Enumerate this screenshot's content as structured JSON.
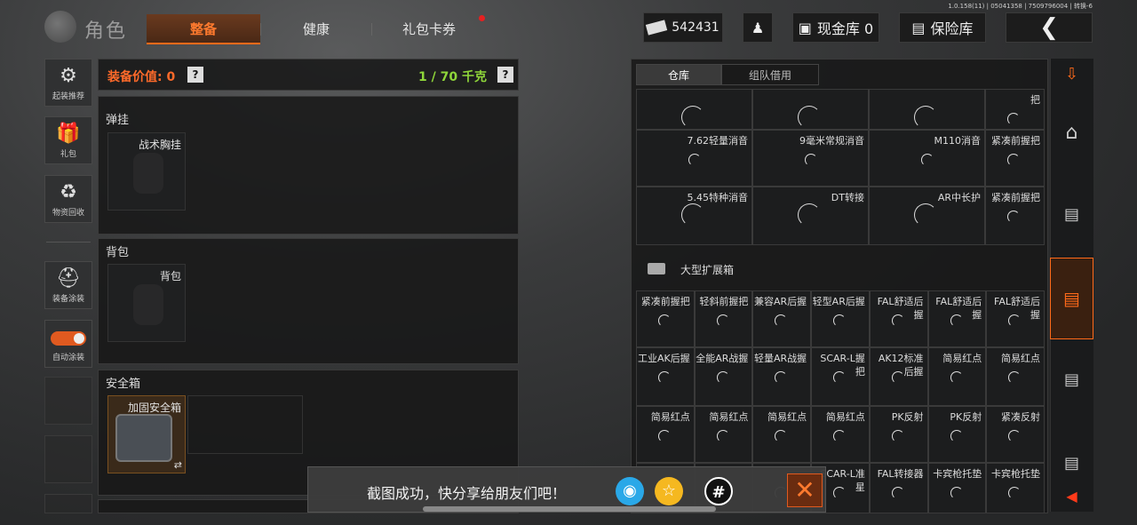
{
  "version": "1.0.158(11) | 05041358 | 7509796004 | 转换-6",
  "header": {
    "title": "角色",
    "tabs": [
      {
        "label": "整备",
        "active": true
      },
      {
        "label": "健康",
        "active": false
      },
      {
        "label": "礼包卡券",
        "active": false
      }
    ],
    "money": "542431",
    "cash_storage": "现金库 0",
    "safe_storage": "保险库"
  },
  "left_sidebar": {
    "items": [
      {
        "label": "起装推荐",
        "icon": "gun-icon"
      },
      {
        "label": "礼包",
        "icon": "gift-icon"
      },
      {
        "label": "物资回收",
        "icon": "recycle-icon"
      },
      {
        "label": "装备涂装",
        "icon": "helmet-icon"
      },
      {
        "label": "自动涂装",
        "icon": "toggle-icon"
      }
    ]
  },
  "equipment": {
    "value_label": "装备价值: 0",
    "weight": "1 / 70 千克",
    "help": "?",
    "sections": [
      {
        "title": "弹挂",
        "slot": "战术胸挂"
      },
      {
        "title": "背包",
        "slot": "背包"
      },
      {
        "title": "安全箱",
        "slot": "加固安全箱"
      }
    ],
    "swap_icon": "⇄"
  },
  "storage": {
    "tabs": [
      {
        "label": "仓库",
        "active": true
      },
      {
        "label": "组队借用",
        "active": false
      }
    ],
    "top_rows": [
      [
        "",
        "",
        "",
        "把"
      ],
      [
        "7.62轻量消音",
        "9毫米常规消音",
        "M110消音",
        "紧凑前握把"
      ],
      [
        "5.45特种消音",
        "DT转接",
        "AR中长护",
        "紧凑前握把"
      ]
    ],
    "large_box_title": "大型扩展箱",
    "box_rows": [
      [
        "紧凑前握把",
        "轻斜前握把",
        "兼容AR后握",
        "轻型AR后握",
        "FAL舒适后握",
        "FAL舒适后握",
        "FAL舒适后握"
      ],
      [
        "工业AK后握",
        "全能AR战握",
        "轻量AR战握",
        "SCAR-L握把",
        "AK12标准后握",
        "简易红点",
        "简易红点"
      ],
      [
        "简易红点",
        "简易红点",
        "简易红点",
        "简易红点",
        "PK反射",
        "PK反射",
        "紧凑反射"
      ],
      [
        "",
        "",
        "",
        "SCAR-L准星",
        "FAL转接器",
        "卡宾枪托垫",
        "卡宾枪托垫"
      ]
    ]
  },
  "toast": {
    "text": "截图成功，快分享给朋友们吧！",
    "close": "✕"
  }
}
